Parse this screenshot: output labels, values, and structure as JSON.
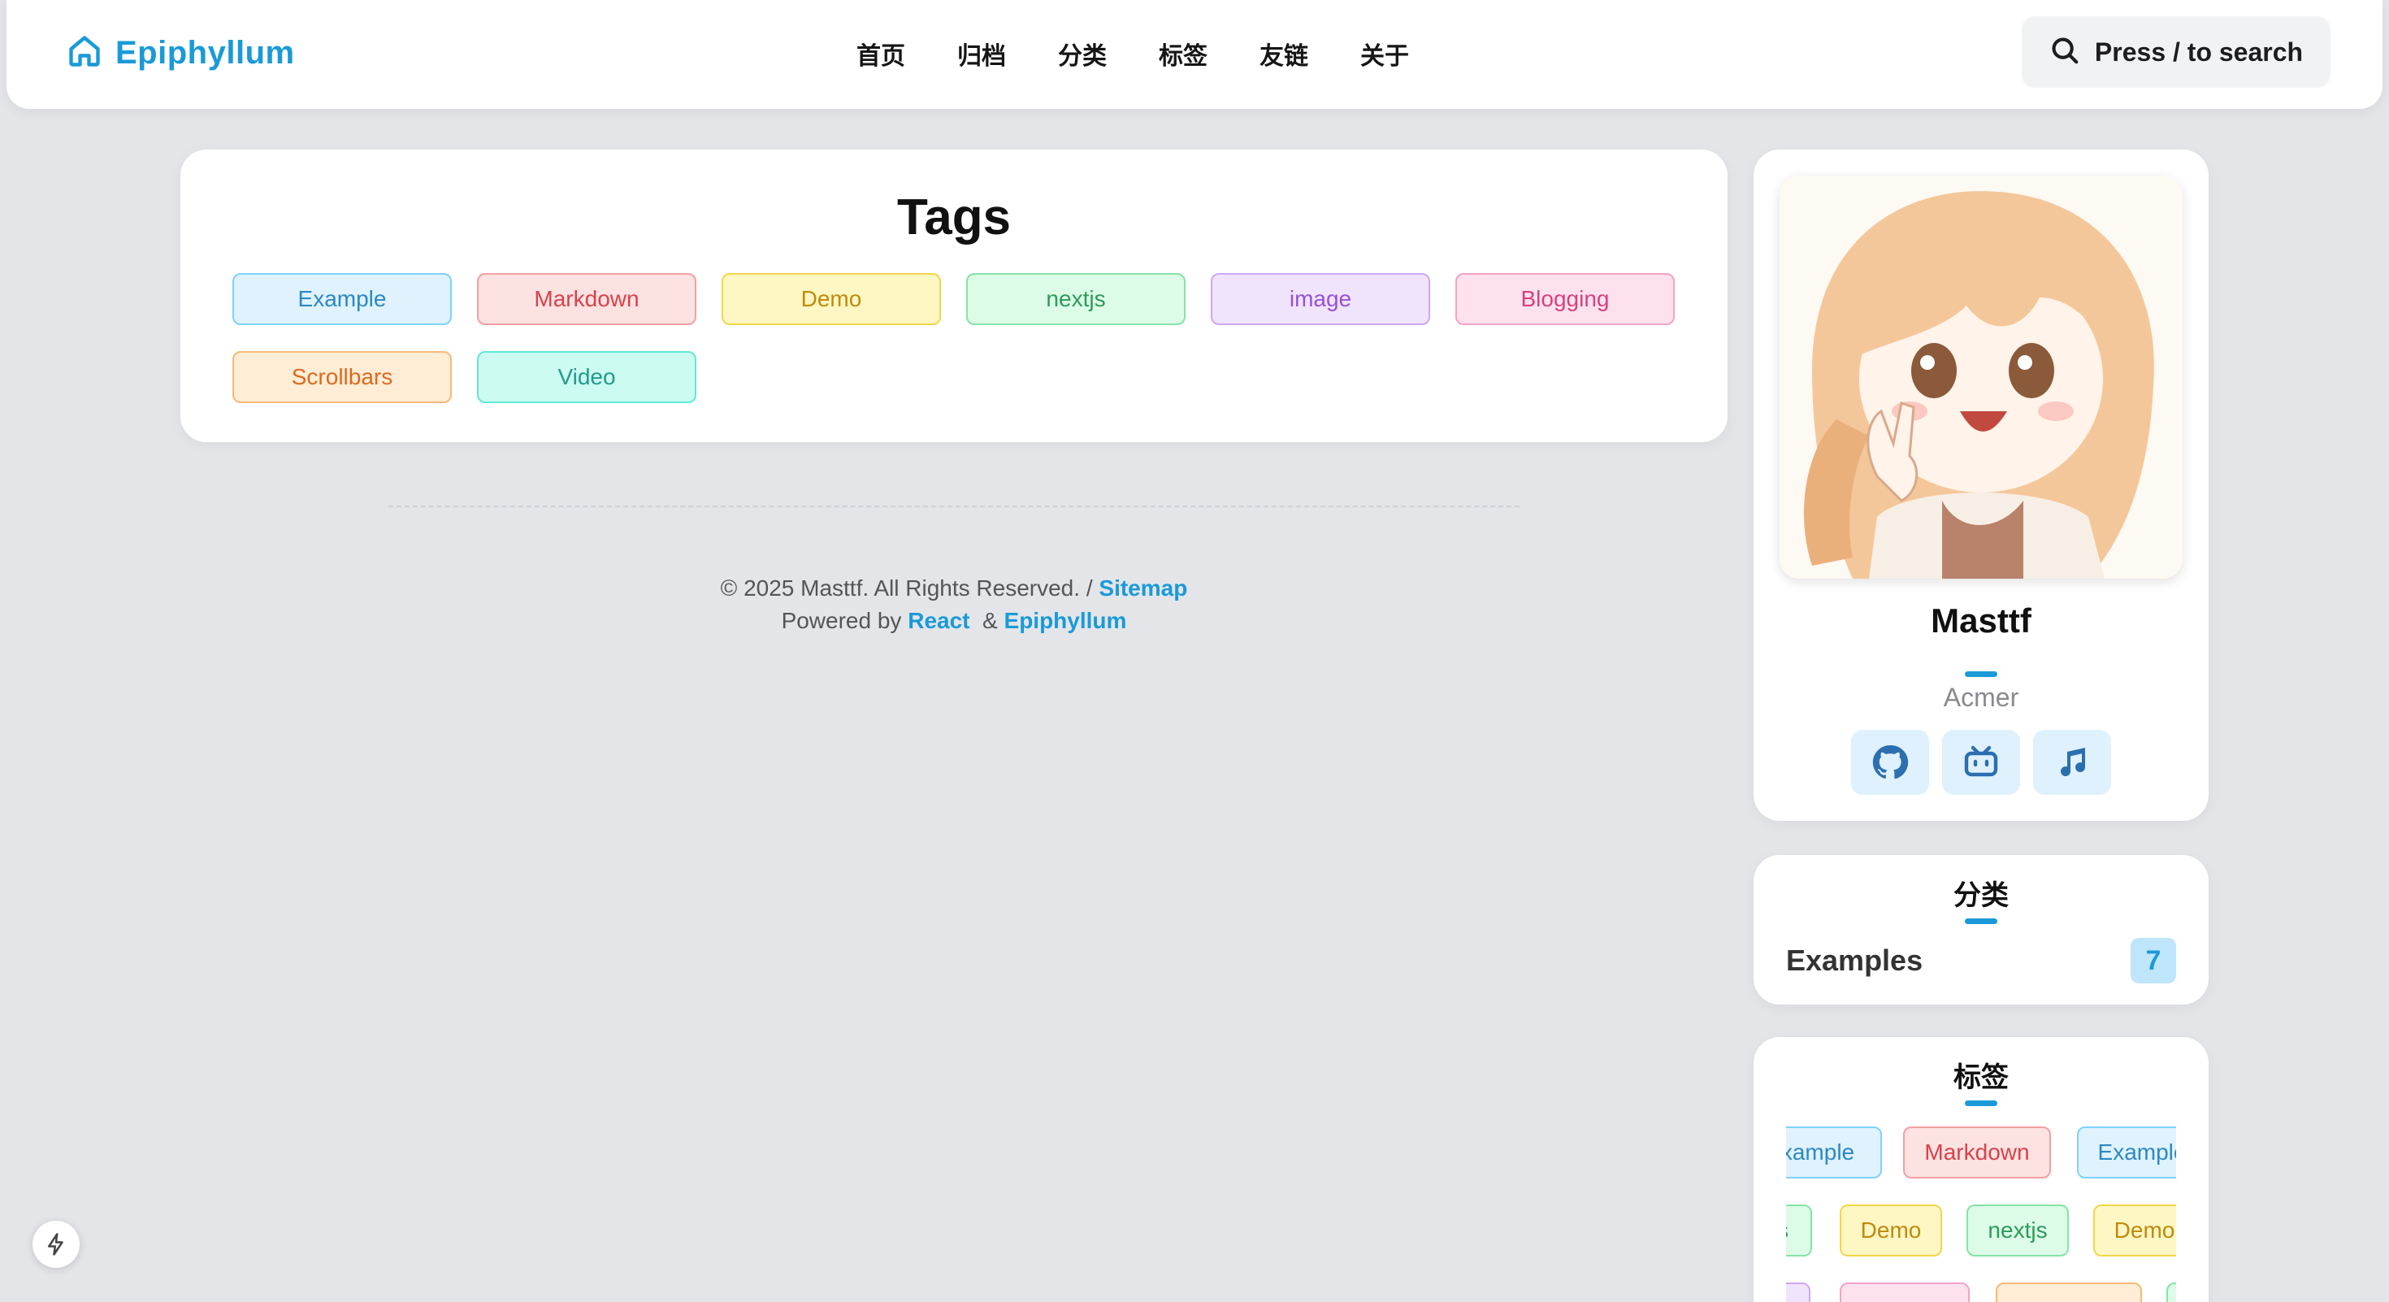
{
  "header": {
    "brand": "Epiphyllum",
    "nav": [
      "首页",
      "归档",
      "分类",
      "标签",
      "友链",
      "关于"
    ],
    "search_label": "Press / to search"
  },
  "tags_page": {
    "title": "Tags",
    "tags": [
      {
        "label": "Example",
        "color": "blue"
      },
      {
        "label": "Markdown",
        "color": "red"
      },
      {
        "label": "Demo",
        "color": "yellow"
      },
      {
        "label": "nextjs",
        "color": "green"
      },
      {
        "label": "image",
        "color": "purple"
      },
      {
        "label": "Blogging",
        "color": "pink"
      },
      {
        "label": "Scrollbars",
        "color": "orange"
      },
      {
        "label": "Video",
        "color": "teal"
      }
    ]
  },
  "footer": {
    "copyright": "© 2025 Masttf. All Rights Reserved. /",
    "sitemap": "Sitemap",
    "powered_by": "Powered by",
    "react": "React",
    "amp": "&",
    "epiphyllum": "Epiphyllum"
  },
  "profile": {
    "name": "Masttf",
    "role": "Acmer",
    "socials": [
      "github-icon",
      "bilibili-icon",
      "music-icon"
    ]
  },
  "categories": {
    "title": "分类",
    "items": [
      {
        "name": "Examples",
        "count": "7"
      }
    ]
  },
  "tag_cloud": {
    "title": "标签",
    "row1": [
      "xample",
      "Markdown",
      "Example"
    ],
    "row2": [
      "s",
      "Demo",
      "nextjs",
      "Demo"
    ]
  },
  "colors": {
    "accent": "#1a9ad8",
    "background": "#e4e5e9"
  }
}
